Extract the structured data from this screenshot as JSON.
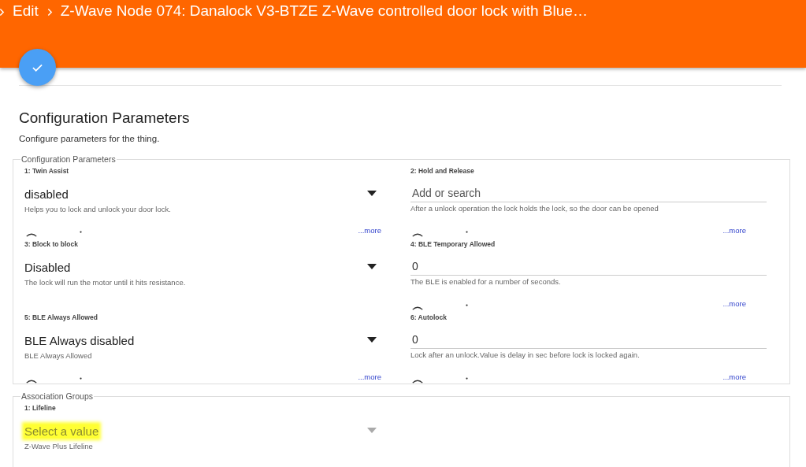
{
  "header": {
    "breadcrumb": [
      "Edit",
      "Z-Wave Node 074: Danalock V3-BTZE Z-Wave controlled door lock with Blue…"
    ]
  },
  "section": {
    "title": "Configuration Parameters",
    "subtitle": "Configure parameters for the thing."
  },
  "config_group": {
    "legend": "Configuration Parameters",
    "parameters": [
      {
        "label": "1: Twin Assist",
        "kind": "select",
        "value": "disabled",
        "description": "Helps you to lock and unlock your door lock.",
        "loading": true,
        "more": "...more"
      },
      {
        "label": "2: Hold and Release",
        "kind": "input",
        "placeholder": "Add or search",
        "description": "After a unlock operation the lock holds the lock, so the door can be opened",
        "loading": true,
        "more": "...more"
      },
      {
        "label": "3: Block to block",
        "kind": "select",
        "value": "Disabled",
        "description": "The lock will run the motor until it hits resistance."
      },
      {
        "label": "4: BLE Temporary Allowed",
        "kind": "input",
        "value": "0",
        "description": "The BLE is enabled for a number of seconds.",
        "loading": true,
        "more": "...more"
      },
      {
        "label": "5: BLE Always Allowed",
        "kind": "select",
        "value": "BLE Always disabled",
        "description": "BLE Always Allowed",
        "loading": true,
        "more": "...more"
      },
      {
        "label": "6: Autolock",
        "kind": "input",
        "value": "0",
        "description": "Lock after an unlock.Value is delay in sec before lock is locked again.",
        "loading": true,
        "more": "...more"
      }
    ]
  },
  "association_group": {
    "legend": "Association Groups",
    "parameters": [
      {
        "label": "1: Lifeline",
        "kind": "select",
        "placeholder": "Select a value",
        "highlighted": true,
        "disabled": true,
        "description": "Z-Wave Plus Lifeline"
      }
    ]
  }
}
